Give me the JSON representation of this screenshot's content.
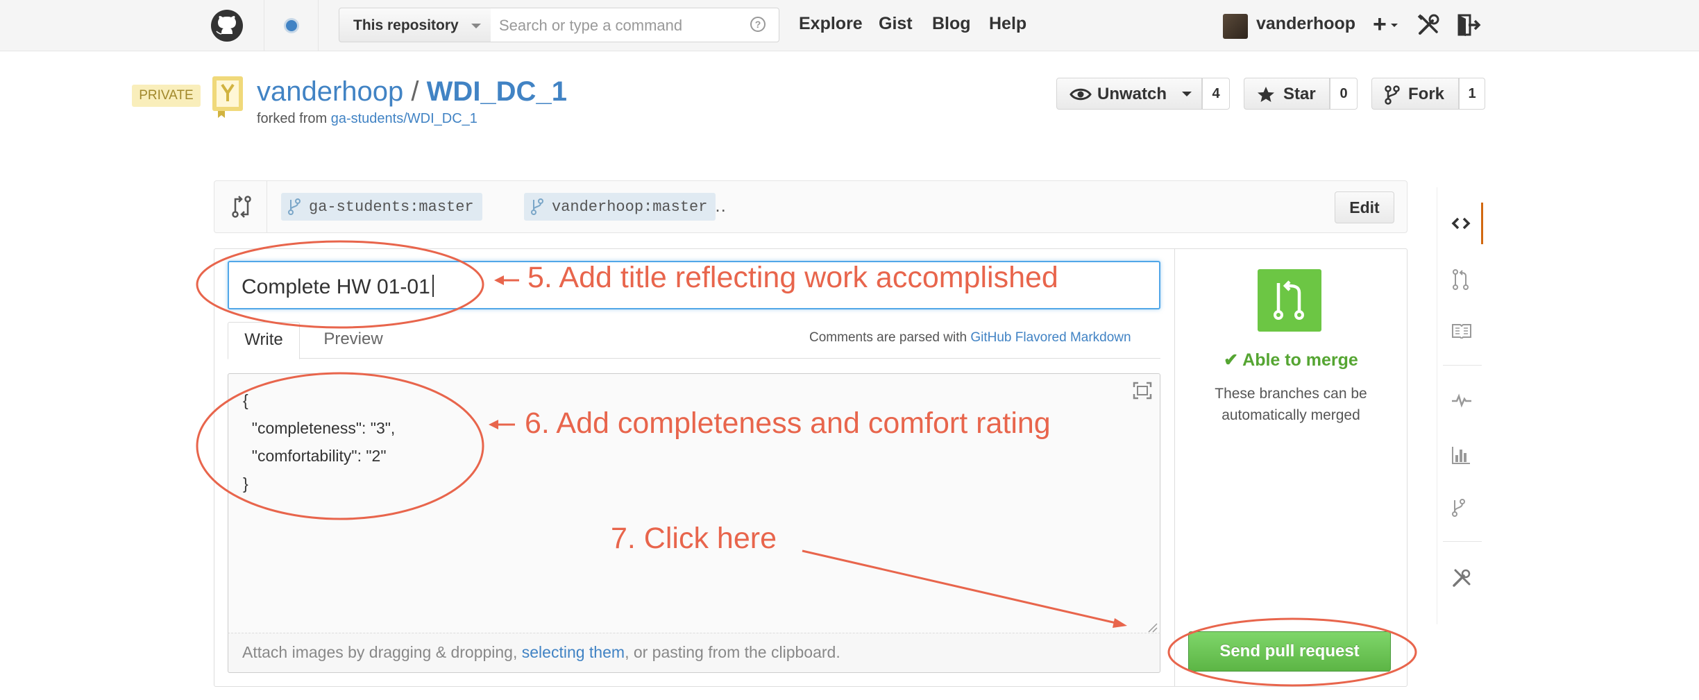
{
  "header": {
    "scope_label": "This repository",
    "search_placeholder": "Search or type a command",
    "help_glyph": "?",
    "nav": [
      "Explore",
      "Gist",
      "Blog",
      "Help"
    ],
    "username": "vanderhoop",
    "plus_glyph": "+"
  },
  "repo": {
    "private_badge": "PRIVATE",
    "owner": "vanderhoop",
    "separator": "/",
    "name": "WDI_DC_1",
    "forked_prefix": "forked from ",
    "forked_source": "ga-students/WDI_DC_1",
    "unwatch_label": "Unwatch",
    "watch_count": "4",
    "star_label": "Star",
    "star_count": "0",
    "fork_label": "Fork",
    "fork_count": "1"
  },
  "compare": {
    "base_branch": "ga-students:master",
    "ellipsis": "…",
    "head_branch": "vanderhoop:master",
    "edit_label": "Edit"
  },
  "form": {
    "title_value": "Complete HW 01-01",
    "tab_write": "Write",
    "tab_preview": "Preview",
    "markdown_note_prefix": "Comments are parsed with ",
    "markdown_link": "GitHub Flavored Markdown",
    "body_lines": [
      "{",
      "  \"completeness\": \"3\",",
      "  \"comfortability\": \"2\"",
      "}"
    ],
    "attach_prefix": "Attach images by dragging & dropping, ",
    "attach_link": "selecting them",
    "attach_suffix": ", or pasting from the clipboard."
  },
  "merge": {
    "check_glyph": "✔",
    "status": "Able to merge",
    "desc_line1": "These branches can be",
    "desc_line2": "automatically merged",
    "submit_label": "Send pull request"
  },
  "annotations": {
    "step5": "5. Add title reflecting work accomplished",
    "step6": "6. Add completeness and comfort rating",
    "step7": "7. Click here"
  },
  "colors": {
    "link_blue": "#4183c4",
    "merge_green": "#6cc644",
    "annotation_red": "#e8654c",
    "private_yellow": "#f9eebb"
  },
  "icons": {
    "logo": "github-octocat-icon",
    "notifications": "notification-dot-icon",
    "tools": "tools-icon",
    "signout": "sign-out-icon",
    "compare": "compare-icon",
    "merge": "merge-icon",
    "sidebar": [
      "code-icon",
      "pull-request-icon",
      "wiki-icon",
      "pulse-icon",
      "graphs-icon",
      "network-icon",
      "settings-icon"
    ]
  }
}
